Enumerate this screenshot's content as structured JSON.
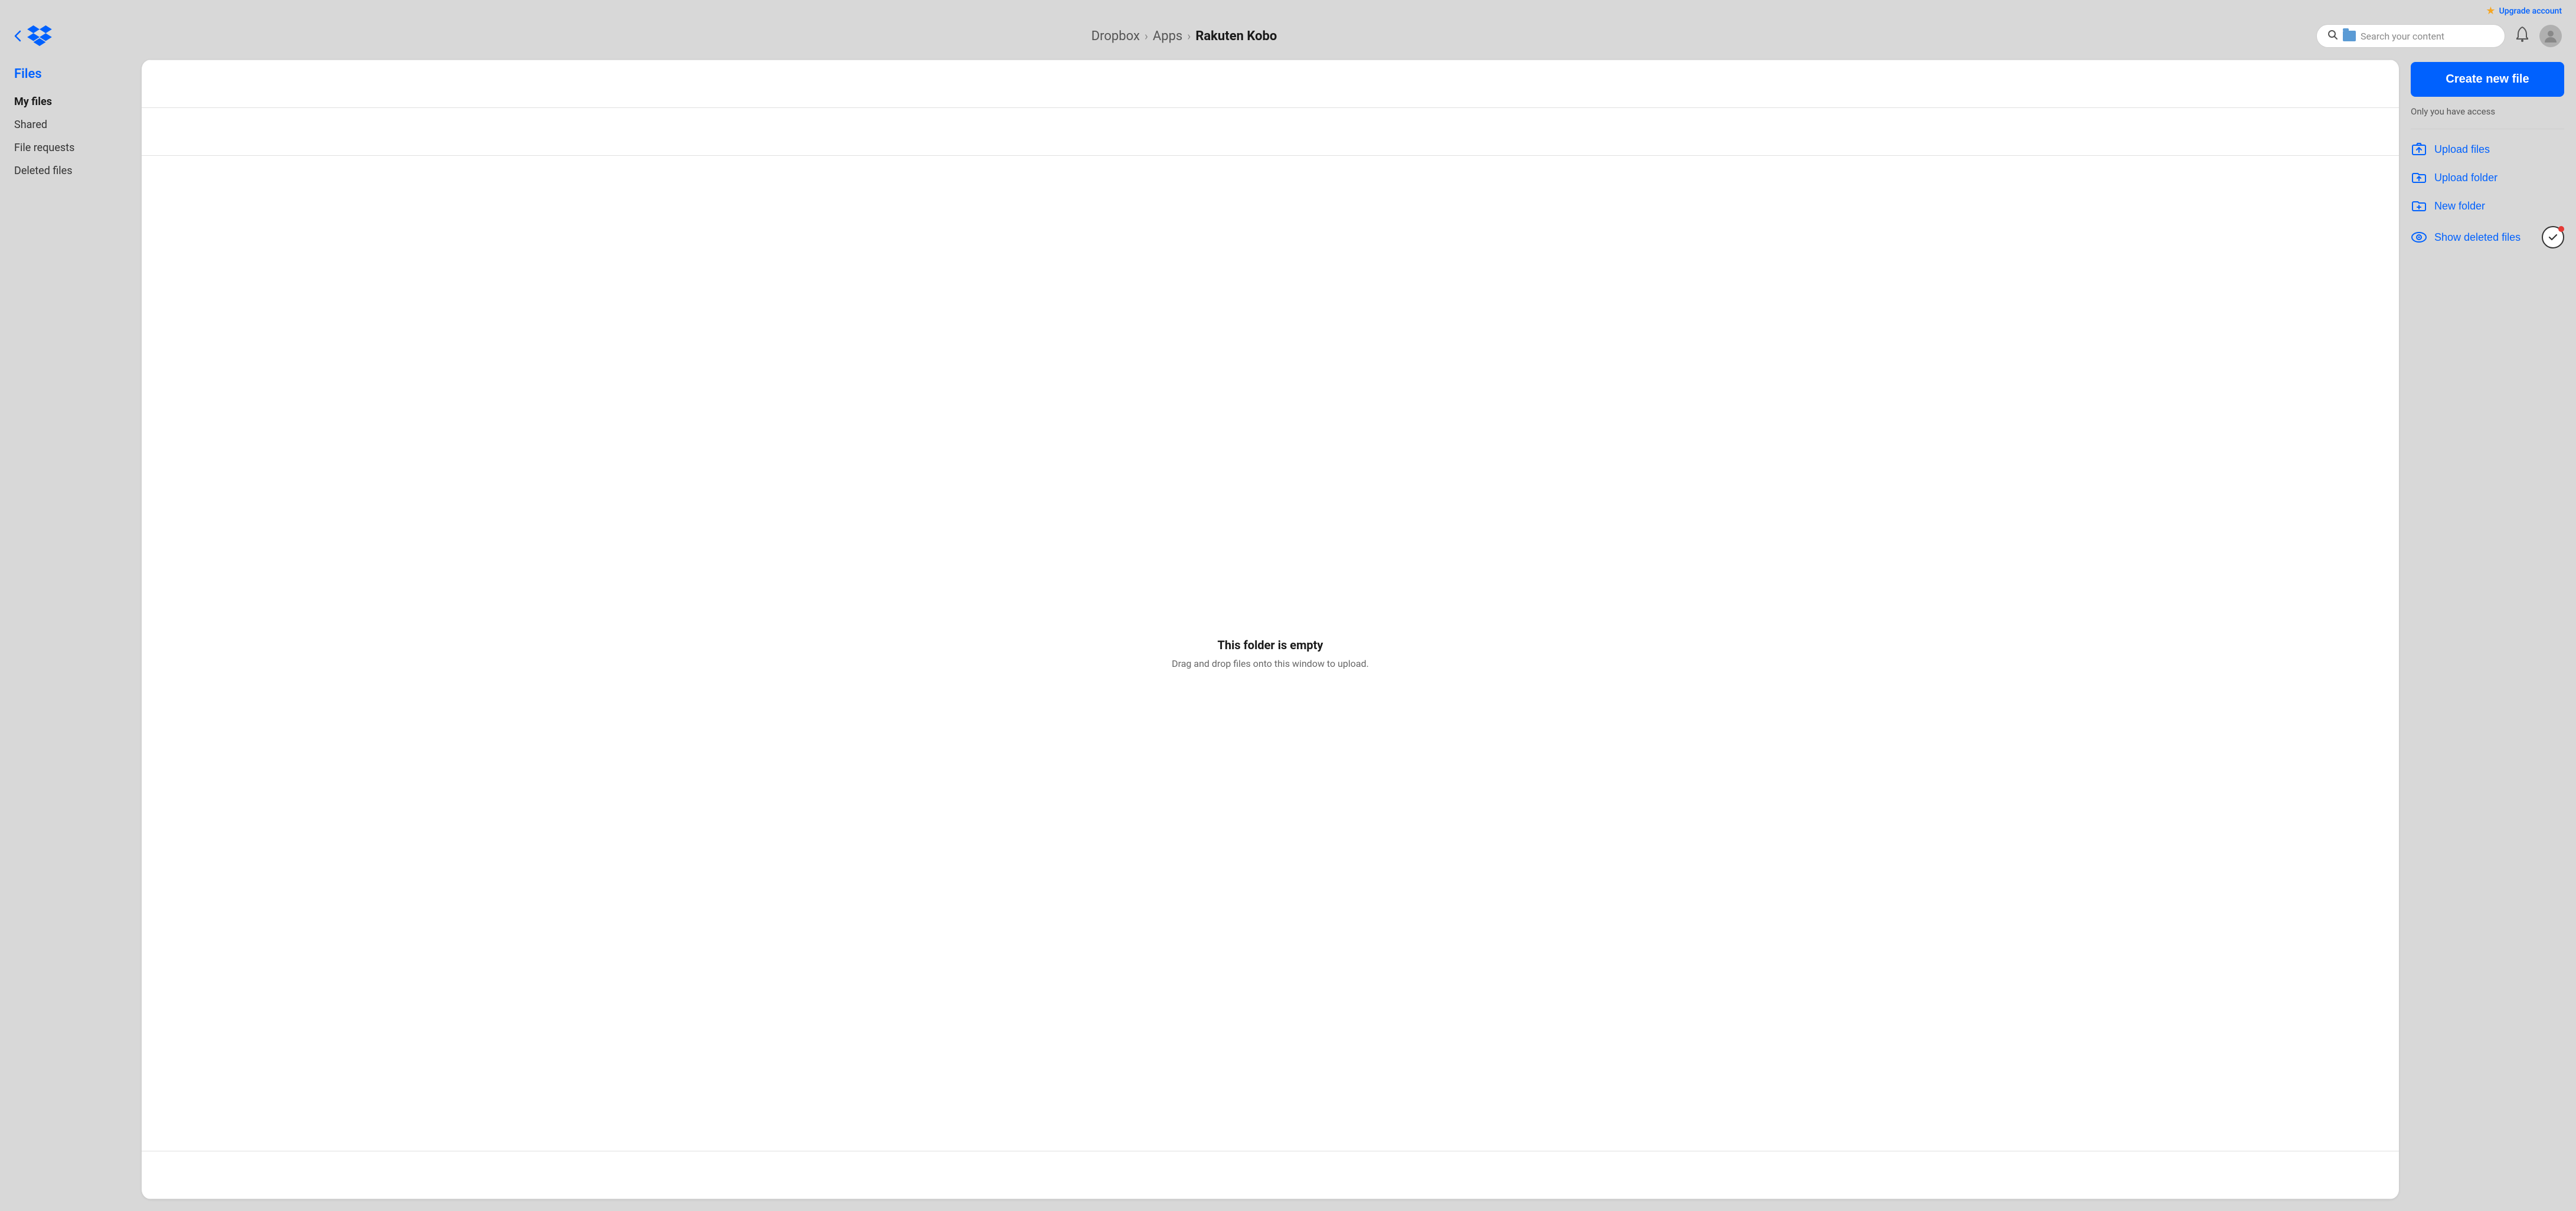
{
  "topbar": {
    "upgrade_label": "Upgrade account"
  },
  "header": {
    "collapse_icon": "chevron-left",
    "breadcrumb": {
      "part1": "Dropbox",
      "sep1": "›",
      "part2": "Apps",
      "sep2": "›",
      "part3": "Rakuten Kobo"
    },
    "search": {
      "placeholder": "Search your content"
    }
  },
  "sidebar": {
    "section_title": "Files",
    "items": [
      {
        "label": "My files",
        "active": true
      },
      {
        "label": "Shared",
        "active": false
      },
      {
        "label": "File requests",
        "active": false
      },
      {
        "label": "Deleted files",
        "active": false
      }
    ]
  },
  "file_browser": {
    "empty_title": "This folder is empty",
    "empty_subtitle": "Drag and drop files onto this window to upload."
  },
  "right_panel": {
    "create_button": "Create new file",
    "access_text": "Only you have access",
    "actions": [
      {
        "label": "Upload files",
        "icon": "upload-files-icon"
      },
      {
        "label": "Upload folder",
        "icon": "upload-folder-icon"
      },
      {
        "label": "New folder",
        "icon": "new-folder-icon"
      },
      {
        "label": "Show deleted files",
        "icon": "show-deleted-icon"
      }
    ]
  }
}
